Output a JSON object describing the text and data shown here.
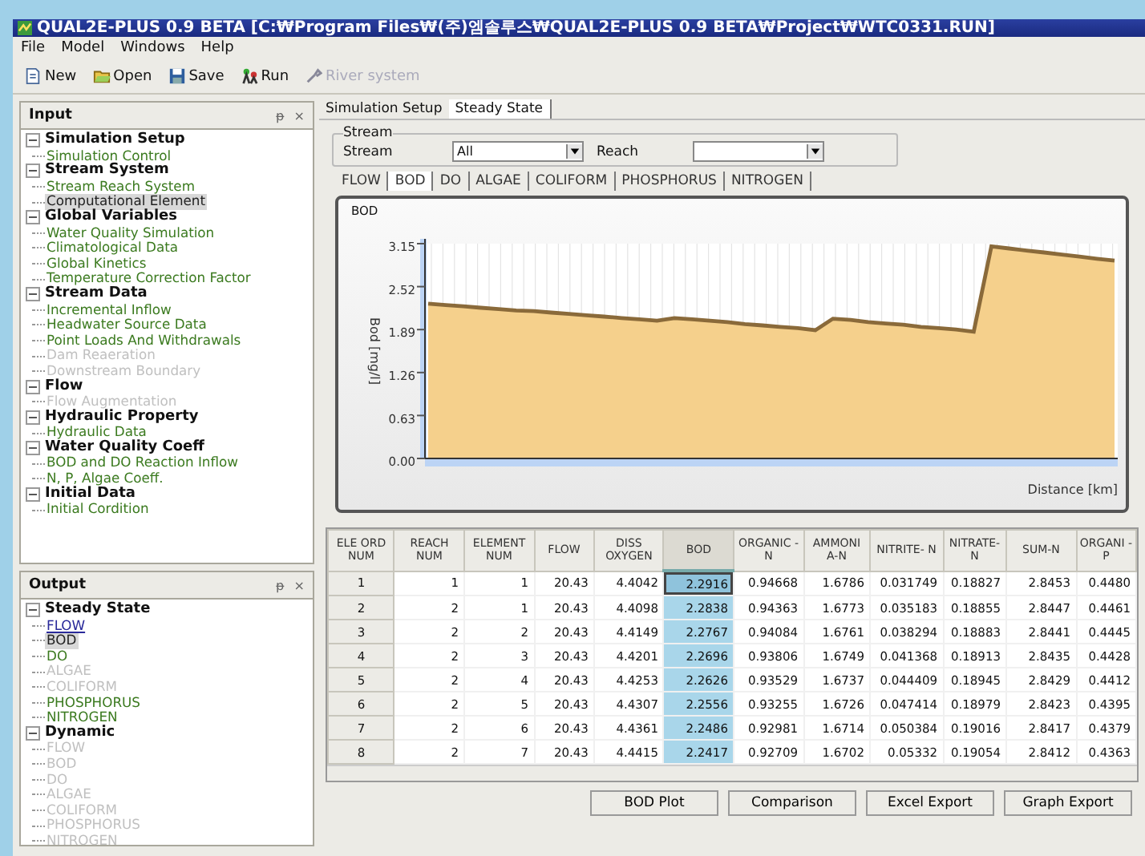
{
  "window": {
    "title": "QUAL2E-PLUS 0.9 BETA  [C:₩Program Files₩(주)엠솔루스₩QUAL2E-PLUS 0.9 BETA₩Project₩WTC0331.RUN]"
  },
  "menu": [
    "File",
    "Model",
    "Windows",
    "Help"
  ],
  "toolbar": [
    {
      "label": "New",
      "kind": "new",
      "disabled": false
    },
    {
      "label": "Open",
      "kind": "open",
      "disabled": false
    },
    {
      "label": "Save",
      "kind": "save",
      "disabled": false
    },
    {
      "label": "Run",
      "kind": "run",
      "disabled": false
    },
    {
      "label": "River system",
      "kind": "tool",
      "disabled": true
    }
  ],
  "input_panel": {
    "title": "Input",
    "pin": "ᵽ",
    "close": "×",
    "tree": [
      {
        "label": "Simulation Setup",
        "expanded": true,
        "children": [
          {
            "label": "Simulation Control",
            "disabled": false,
            "selected": false
          }
        ]
      },
      {
        "label": "Stream System",
        "expanded": true,
        "children": [
          {
            "label": "Stream Reach System",
            "disabled": false,
            "selected": false
          },
          {
            "label": "Computational Element",
            "disabled": false,
            "selected": true
          }
        ]
      },
      {
        "label": "Global Variables",
        "expanded": true,
        "children": [
          {
            "label": "Water Quality Simulation",
            "disabled": false,
            "selected": false
          },
          {
            "label": "Climatological Data",
            "disabled": false,
            "selected": false
          },
          {
            "label": "Global Kinetics",
            "disabled": false,
            "selected": false
          },
          {
            "label": "Temperature Correction Factor",
            "disabled": false,
            "selected": false
          }
        ]
      },
      {
        "label": "Stream Data",
        "expanded": true,
        "children": [
          {
            "label": "Incremental Inflow",
            "disabled": false,
            "selected": false
          },
          {
            "label": "Headwater Source Data",
            "disabled": false,
            "selected": false
          },
          {
            "label": "Point Loads And Withdrawals",
            "disabled": false,
            "selected": false
          },
          {
            "label": "Dam Reaeration",
            "disabled": true,
            "selected": false
          },
          {
            "label": "Downstream Boundary",
            "disabled": true,
            "selected": false
          }
        ]
      },
      {
        "label": "Flow",
        "expanded": true,
        "children": [
          {
            "label": "Flow Augmentation",
            "disabled": true,
            "selected": false
          }
        ]
      },
      {
        "label": "Hydraulic Property",
        "expanded": true,
        "children": [
          {
            "label": "Hydraulic Data",
            "disabled": false,
            "selected": false
          }
        ]
      },
      {
        "label": "Water Quality Coeff",
        "expanded": true,
        "children": [
          {
            "label": "BOD and DO Reaction Inflow",
            "disabled": false,
            "selected": false
          },
          {
            "label": "N, P, Algae Coeff.",
            "disabled": false,
            "selected": false
          }
        ]
      },
      {
        "label": "Initial Data",
        "expanded": true,
        "children": [
          {
            "label": "Initial Cordition",
            "disabled": false,
            "selected": false
          }
        ]
      }
    ]
  },
  "output_panel": {
    "title": "Output",
    "pin": "ᵽ",
    "close": "×",
    "tree": [
      {
        "label": "Steady State",
        "expanded": true,
        "children": [
          {
            "label": "FLOW",
            "disabled": false,
            "selected": false,
            "link": true
          },
          {
            "label": "BOD",
            "disabled": false,
            "selected": true,
            "link": false
          },
          {
            "label": "DO",
            "disabled": false,
            "selected": false,
            "link": false
          },
          {
            "label": "ALGAE",
            "disabled": true,
            "selected": false,
            "link": false
          },
          {
            "label": "COLIFORM",
            "disabled": true,
            "selected": false,
            "link": false
          },
          {
            "label": "PHOSPHORUS",
            "disabled": false,
            "selected": false,
            "link": false
          },
          {
            "label": "NITROGEN",
            "disabled": false,
            "selected": false,
            "link": false
          }
        ]
      },
      {
        "label": "Dynamic",
        "expanded": true,
        "children": [
          {
            "label": "FLOW",
            "disabled": true,
            "selected": false,
            "link": false
          },
          {
            "label": "BOD",
            "disabled": true,
            "selected": false,
            "link": false
          },
          {
            "label": "DO",
            "disabled": true,
            "selected": false,
            "link": false
          },
          {
            "label": "ALGAE",
            "disabled": true,
            "selected": false,
            "link": false
          },
          {
            "label": "COLIFORM",
            "disabled": true,
            "selected": false,
            "link": false
          },
          {
            "label": "PHOSPHORUS",
            "disabled": true,
            "selected": false,
            "link": false
          },
          {
            "label": "NITROGEN",
            "disabled": true,
            "selected": false,
            "link": false
          }
        ]
      }
    ]
  },
  "doc_tabs": [
    {
      "label": "Simulation Setup",
      "selected": false
    },
    {
      "label": "Steady State",
      "selected": true
    }
  ],
  "stream_group": {
    "title": "Stream",
    "stream_label": "Stream",
    "stream_value": "All",
    "reach_label": "Reach"
  },
  "result_tabs": [
    {
      "label": "FLOW",
      "selected": false
    },
    {
      "label": "BOD",
      "selected": true
    },
    {
      "label": "DO",
      "selected": false
    },
    {
      "label": "ALGAE",
      "selected": false
    },
    {
      "label": "COLIFORM",
      "selected": false
    },
    {
      "label": "PHOSPHORUS",
      "selected": false
    },
    {
      "label": "NITROGEN",
      "selected": false
    }
  ],
  "chart": {
    "chart_data": {
      "type": "area",
      "title": "BOD",
      "xlabel": "Distance [km]",
      "ylabel": "Bod [mg/l]",
      "ylim": [
        0,
        3.15
      ],
      "yticks": [
        {
          "value": 0,
          "label": "0.00"
        },
        {
          "value": 0.63,
          "label": "0.63"
        },
        {
          "value": 1.26,
          "label": "1.26"
        },
        {
          "value": 1.89,
          "label": "1.89"
        },
        {
          "value": 2.52,
          "label": "2.52"
        },
        {
          "value": 3.15,
          "label": "3.15"
        }
      ],
      "grid": true,
      "series": [
        {
          "color": "#f5d08c",
          "values": [
            2.27,
            2.25,
            2.23,
            2.21,
            2.19,
            2.17,
            2.16,
            2.14,
            2.12,
            2.1,
            2.08,
            2.06,
            2.04,
            2.02,
            2.06,
            2.04,
            2.02,
            2.0,
            1.97,
            1.95,
            1.93,
            1.91,
            1.88,
            2.05,
            2.03,
            2.0,
            1.98,
            1.96,
            1.93,
            1.91,
            1.89,
            1.86,
            3.11,
            3.08,
            3.05,
            3.02,
            2.99,
            2.96,
            2.93,
            2.9
          ]
        }
      ]
    }
  },
  "table": {
    "columns": [
      {
        "label": "ELE ORD NUM",
        "selected": false
      },
      {
        "label": "REACH NUM",
        "selected": false
      },
      {
        "label": "ELEMENT NUM",
        "selected": false
      },
      {
        "label": "FLOW",
        "selected": false
      },
      {
        "label": "DISS OXYGEN",
        "selected": false
      },
      {
        "label": "BOD",
        "selected": true
      },
      {
        "label": "ORGANIC -N",
        "selected": false
      },
      {
        "label": "AMMONI A-N",
        "selected": false
      },
      {
        "label": "NITRITE- N",
        "selected": false
      },
      {
        "label": "NITRATE- N",
        "selected": false
      },
      {
        "label": "SUM-N",
        "selected": false
      },
      {
        "label": "ORGANI -P",
        "selected": false
      }
    ],
    "rows": [
      {
        "cells": [
          "1",
          "1",
          "1",
          "20.43",
          "4.4042",
          "2.2916",
          "0.94668",
          "1.6786",
          "0.031749",
          "0.18827",
          "2.8453",
          "0.4480"
        ],
        "focused": true
      },
      {
        "cells": [
          "2",
          "2",
          "1",
          "20.43",
          "4.4098",
          "2.2838",
          "0.94363",
          "1.6773",
          "0.035183",
          "0.18855",
          "2.8447",
          "0.4461"
        ],
        "focused": false
      },
      {
        "cells": [
          "3",
          "2",
          "2",
          "20.43",
          "4.4149",
          "2.2767",
          "0.94084",
          "1.6761",
          "0.038294",
          "0.18883",
          "2.8441",
          "0.4445"
        ],
        "focused": false
      },
      {
        "cells": [
          "4",
          "2",
          "3",
          "20.43",
          "4.4201",
          "2.2696",
          "0.93806",
          "1.6749",
          "0.041368",
          "0.18913",
          "2.8435",
          "0.4428"
        ],
        "focused": false
      },
      {
        "cells": [
          "5",
          "2",
          "4",
          "20.43",
          "4.4253",
          "2.2626",
          "0.93529",
          "1.6737",
          "0.044409",
          "0.18945",
          "2.8429",
          "0.4412"
        ],
        "focused": false
      },
      {
        "cells": [
          "6",
          "2",
          "5",
          "20.43",
          "4.4307",
          "2.2556",
          "0.93255",
          "1.6726",
          "0.047414",
          "0.18979",
          "2.8423",
          "0.4395"
        ],
        "focused": false
      },
      {
        "cells": [
          "7",
          "2",
          "6",
          "20.43",
          "4.4361",
          "2.2486",
          "0.92981",
          "1.6714",
          "0.050384",
          "0.19016",
          "2.8417",
          "0.4379"
        ],
        "focused": false
      },
      {
        "cells": [
          "8",
          "2",
          "7",
          "20.43",
          "4.4415",
          "2.2417",
          "0.92709",
          "1.6702",
          "0.05332",
          "0.19054",
          "2.8412",
          "0.4363"
        ],
        "focused": false
      }
    ]
  },
  "buttons": [
    "BOD Plot",
    "Comparison",
    "Excel Export",
    "Graph Export"
  ]
}
